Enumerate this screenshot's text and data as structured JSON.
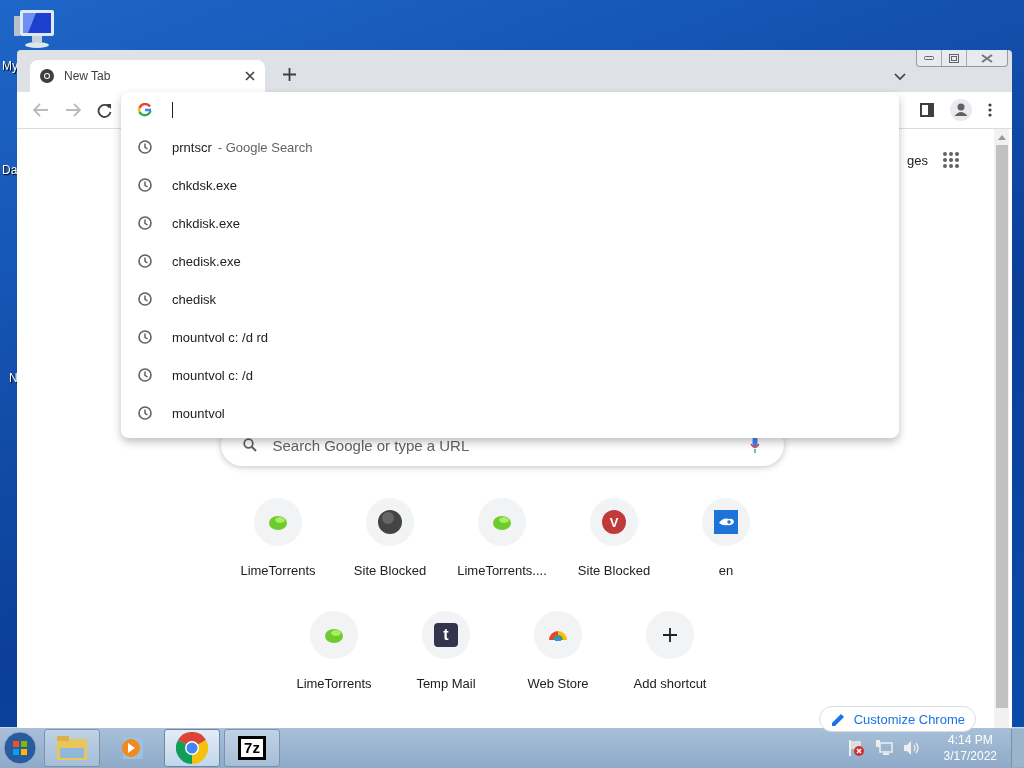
{
  "desktop": {
    "icon_labels": [
      "My",
      "Da",
      "N"
    ]
  },
  "browser": {
    "tabs": [
      {
        "title": "New Tab",
        "selected": true
      }
    ],
    "omnibox": {
      "suggestions": [
        {
          "text": "prntscr",
          "description": "- Google Search"
        },
        {
          "text": "chkdsk.exe"
        },
        {
          "text": "chkdisk.exe"
        },
        {
          "text": "chedisk.exe"
        },
        {
          "text": "chedisk"
        },
        {
          "text": "mountvol c: /d rd"
        },
        {
          "text": "mountvol c: /d"
        },
        {
          "text": "mountvol"
        }
      ]
    }
  },
  "new_tab_page": {
    "partial_link": "ges",
    "search_placeholder": "Search Google or type a URL",
    "shortcut_rows": [
      [
        {
          "label": "LimeTorrents",
          "kind": "lime"
        },
        {
          "label": "Site Blocked",
          "kind": "ball"
        },
        {
          "label": "LimeTorrents....",
          "kind": "lime"
        },
        {
          "label": "Site Blocked",
          "kind": "letter",
          "icon_text": "V"
        },
        {
          "label": "en",
          "kind": "cloud"
        }
      ],
      [
        {
          "label": "LimeTorrents",
          "kind": "lime"
        },
        {
          "label": "Temp Mail",
          "kind": "square",
          "icon_text": "t"
        },
        {
          "label": "Web Store",
          "kind": "store"
        },
        {
          "label": "Add shortcut",
          "kind": "add"
        }
      ]
    ],
    "customize_button": "Customize Chrome"
  },
  "taskbar": {
    "buttons": [
      {
        "kind": "explorer",
        "running": true,
        "selected": false
      },
      {
        "kind": "media",
        "running": false,
        "selected": false
      },
      {
        "kind": "chrome",
        "running": true,
        "selected": true
      },
      {
        "kind": "archive",
        "running": true,
        "selected": false,
        "icon_text": "7z"
      }
    ],
    "clock": {
      "time": "4:14 PM",
      "date": "3/17/2022"
    }
  }
}
